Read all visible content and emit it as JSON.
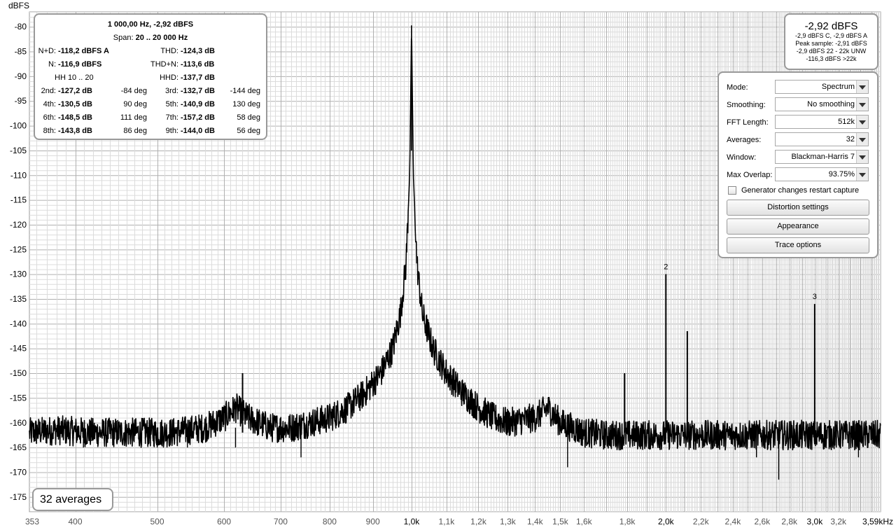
{
  "chart_data": {
    "type": "line",
    "ylabel": "dBFS",
    "x_scale": "log",
    "xlim": [
      353,
      3590
    ],
    "ylim": [
      -178,
      -77
    ],
    "grid": true,
    "y_ticks": [
      -80,
      -85,
      -90,
      -95,
      -100,
      -105,
      -110,
      -115,
      -120,
      -125,
      -130,
      -135,
      -140,
      -145,
      -150,
      -155,
      -160,
      -165,
      -170,
      -175
    ],
    "x_ticks": [
      {
        "v": 353,
        "label": "353"
      },
      {
        "v": 400,
        "label": "400"
      },
      {
        "v": 500,
        "label": "500"
      },
      {
        "v": 600,
        "label": "600"
      },
      {
        "v": 700,
        "label": "700"
      },
      {
        "v": 800,
        "label": "800"
      },
      {
        "v": 900,
        "label": "900"
      },
      {
        "v": 1000,
        "label": "1,0k",
        "bold": true
      },
      {
        "v": 1100,
        "label": "1,1k"
      },
      {
        "v": 1200,
        "label": "1,2k"
      },
      {
        "v": 1300,
        "label": "1,3k"
      },
      {
        "v": 1400,
        "label": "1,4k"
      },
      {
        "v": 1500,
        "label": "1,5k"
      },
      {
        "v": 1600,
        "label": "1,6k"
      },
      {
        "v": 1800,
        "label": "1,8k"
      },
      {
        "v": 2000,
        "label": "2,0k",
        "bold": true
      },
      {
        "v": 2200,
        "label": "2,2k"
      },
      {
        "v": 2400,
        "label": "2,4k"
      },
      {
        "v": 2600,
        "label": "2,6k"
      },
      {
        "v": 2800,
        "label": "2,8k"
      },
      {
        "v": 3000,
        "label": "3,0k",
        "bold": true
      },
      {
        "v": 3200,
        "label": "3,2k"
      },
      {
        "v": 3590,
        "label": "3,59kHz",
        "bold": true
      }
    ],
    "spectrum": [
      [
        353,
        -162
      ],
      [
        380,
        -161.5
      ],
      [
        420,
        -162
      ],
      [
        470,
        -162
      ],
      [
        520,
        -162
      ],
      [
        570,
        -161
      ],
      [
        600,
        -159
      ],
      [
        620,
        -157
      ],
      [
        640,
        -159
      ],
      [
        680,
        -161
      ],
      [
        720,
        -161
      ],
      [
        760,
        -160
      ],
      [
        800,
        -159
      ],
      [
        840,
        -157
      ],
      [
        880,
        -154
      ],
      [
        920,
        -150
      ],
      [
        950,
        -145
      ],
      [
        970,
        -138
      ],
      [
        985,
        -128
      ],
      [
        995,
        -110
      ],
      [
        1000,
        -80
      ],
      [
        1005,
        -110
      ],
      [
        1015,
        -128
      ],
      [
        1030,
        -138
      ],
      [
        1060,
        -145
      ],
      [
        1100,
        -150
      ],
      [
        1150,
        -154
      ],
      [
        1200,
        -157
      ],
      [
        1250,
        -159
      ],
      [
        1300,
        -160
      ],
      [
        1400,
        -159
      ],
      [
        1450,
        -157
      ],
      [
        1500,
        -160
      ],
      [
        1600,
        -162
      ],
      [
        1700,
        -162.5
      ],
      [
        1800,
        -162.5
      ],
      [
        2000,
        -162.5
      ],
      [
        2200,
        -162.5
      ],
      [
        2400,
        -162.5
      ],
      [
        2600,
        -162.5
      ],
      [
        2800,
        -162.5
      ],
      [
        3000,
        -162.5
      ],
      [
        3200,
        -162.5
      ],
      [
        3590,
        -162.5
      ]
    ],
    "noise_spread_db": 3,
    "dips": [
      [
        409,
        -165
      ],
      [
        500,
        -165
      ],
      [
        543,
        -165
      ],
      [
        619,
        -165
      ],
      [
        740,
        -167
      ],
      [
        1530,
        -169
      ],
      [
        2560,
        -167
      ],
      [
        2720,
        -171.5
      ],
      [
        3380,
        -167
      ]
    ],
    "spikes": [
      {
        "x": 631,
        "top": -150
      },
      {
        "x": 1787,
        "top": -150
      },
      {
        "x": 2000,
        "top": -130,
        "label": "2"
      },
      {
        "x": 2120,
        "top": -141.5
      },
      {
        "x": 3000,
        "top": -136,
        "label": "3"
      }
    ]
  },
  "distortion": {
    "header1": "1 000,00 Hz, -2,92 dBFS",
    "span_prefix": "Span:",
    "span_value": "20 .. 20 000 Hz",
    "nd_label": "N+D:",
    "nd_value": "-118,2 dBFS A",
    "thd_label": "THD:",
    "thd_value": "-124,3 dB",
    "n_label": "N:",
    "n_value": "-116,9 dBFS",
    "thdn_label": "THD+N:",
    "thdn_value": "-113,6 dB",
    "hh_label": "HH 10 .. 20",
    "hhd_label": "HHD:",
    "hhd_value": "-137,7 dB",
    "harmonics": [
      {
        "l1": "2nd:",
        "v1": "-127,2 dB",
        "d1": "-84 deg",
        "l2": "3rd:",
        "v2": "-132,7 dB",
        "d2": "-144 deg"
      },
      {
        "l1": "4th:",
        "v1": "-130,5 dB",
        "d1": "90 deg",
        "l2": "5th:",
        "v2": "-140,9 dB",
        "d2": "130 deg"
      },
      {
        "l1": "6th:",
        "v1": "-148,5 dB",
        "d1": "111 deg",
        "l2": "7th:",
        "v2": "-157,2 dB",
        "d2": "58 deg"
      },
      {
        "l1": "8th:",
        "v1": "-143,8 dB",
        "d1": "86 deg",
        "l2": "9th:",
        "v2": "-144,0 dB",
        "d2": "56 deg"
      }
    ]
  },
  "level": {
    "main": "-2,92 dBFS",
    "line1": "-2,9 dBFS C, -2,9 dBFS A",
    "line2": "Peak sample: -2,91 dBFS",
    "line3": "-2,9 dBFS 22 - 22k UNW",
    "line4": "-116,3 dBFS >22k"
  },
  "settings": {
    "mode_label": "Mode:",
    "mode_value": "Spectrum",
    "smoothing_label": "Smoothing:",
    "smoothing_value": "No  smoothing",
    "fft_label": "FFT Length:",
    "fft_value": "512k",
    "averages_label": "Averages:",
    "averages_value": "32",
    "window_label": "Window:",
    "window_value": "Blackman-Harris 7",
    "overlap_label": "Max Overlap:",
    "overlap_value": "93.75%",
    "generator_label": "Generator changes restart capture",
    "distortion_btn": "Distortion settings",
    "appearance_btn": "Appearance",
    "trace_btn": "Trace options"
  },
  "averages_box": "32 averages",
  "colors": {
    "trace": "#000000",
    "grid_major": "#b0b0b0",
    "grid_minor": "#dcdcdc",
    "frame": "#999999"
  }
}
